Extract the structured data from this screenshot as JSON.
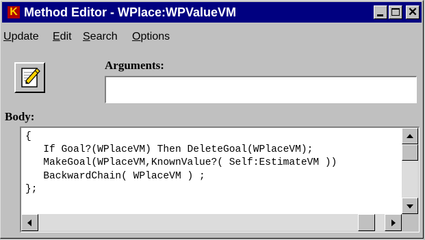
{
  "window": {
    "title": "Method Editor - WPlace:WPValueVM",
    "app_icon": "K"
  },
  "menu": {
    "items": [
      {
        "label": "Update",
        "mnemonic": "U",
        "rest": "pdate"
      },
      {
        "label": "Edit",
        "mnemonic": "E",
        "rest": "dit"
      },
      {
        "label": "Search",
        "mnemonic": "S",
        "rest": "earch"
      },
      {
        "label": "Options",
        "mnemonic": "O",
        "rest": "ptions"
      }
    ]
  },
  "editor": {
    "arguments_label": "Arguments:",
    "arguments_value": "",
    "body_label": "Body:",
    "body_text": "{\n   If Goal?(WPlaceVM) Then DeleteGoal(WPlaceVM);\n   MakeGoal(WPlaceVM,KnownValue?( Self:EstimateVM ))\n   BackwardChain( WPlaceVM ) ;\n};"
  },
  "scroll": {
    "vertical_position": 0.1,
    "horizontal_position": 0.0
  },
  "icons": {
    "tool_button": "notepad-pencil-icon"
  }
}
